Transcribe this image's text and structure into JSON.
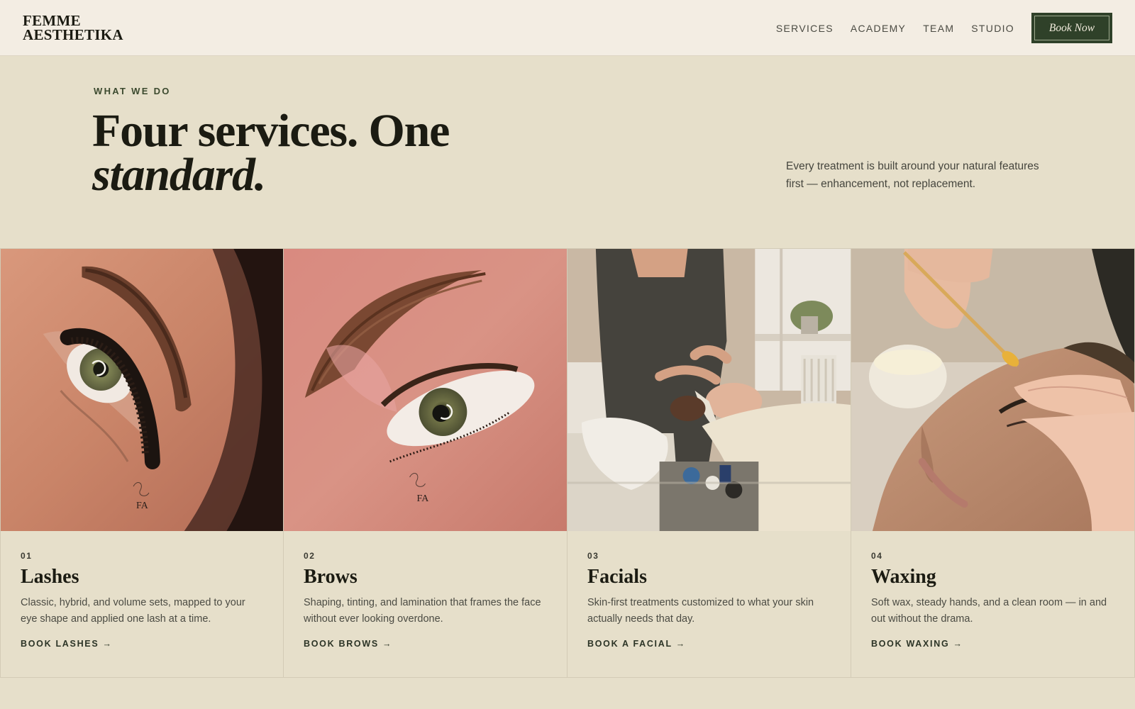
{
  "brand": {
    "line1": "FEMME",
    "line2": "AESTHETIKA"
  },
  "nav": {
    "items": [
      {
        "label": "SERVICES"
      },
      {
        "label": "ACADEMY"
      },
      {
        "label": "TEAM"
      },
      {
        "label": "STUDIO"
      }
    ],
    "cta_label": "Book Now"
  },
  "hero": {
    "eyebrow": "WHAT WE DO",
    "title_line1": "Four services. One",
    "title_line2": "standard.",
    "intro": "Every treatment is built around your natural features first — enhancement, not replacement."
  },
  "services": [
    {
      "number": "01",
      "title": "Lashes",
      "description": "Classic, hybrid, and volume sets, mapped to your eye shape and applied one lash at a time.",
      "cta": "BOOK LASHES →",
      "photo": "lash-extension-closeup",
      "watermark": "FA"
    },
    {
      "number": "02",
      "title": "Brows",
      "description": "Shaping, tinting, and lamination that frames the face without ever looking overdone.",
      "cta": "BOOK BROWS →",
      "photo": "brow-lamination-closeup",
      "watermark": "FA"
    },
    {
      "number": "03",
      "title": "Facials",
      "description": "Skin-first treatments customized to what your skin actually needs that day.",
      "cta": "BOOK A FACIAL →",
      "photo": "facial-treatment-room"
    },
    {
      "number": "04",
      "title": "Waxing",
      "description": "Soft wax, steady hands, and a clean room — in and out without the drama.",
      "cta": "BOOK WAXING →",
      "photo": "brow-waxing-closeup"
    }
  ],
  "colors": {
    "page_bg": "#e6dfca",
    "header_bg": "#f3ede3",
    "accent_green": "#2f4129",
    "ink": "#1b1b12"
  }
}
